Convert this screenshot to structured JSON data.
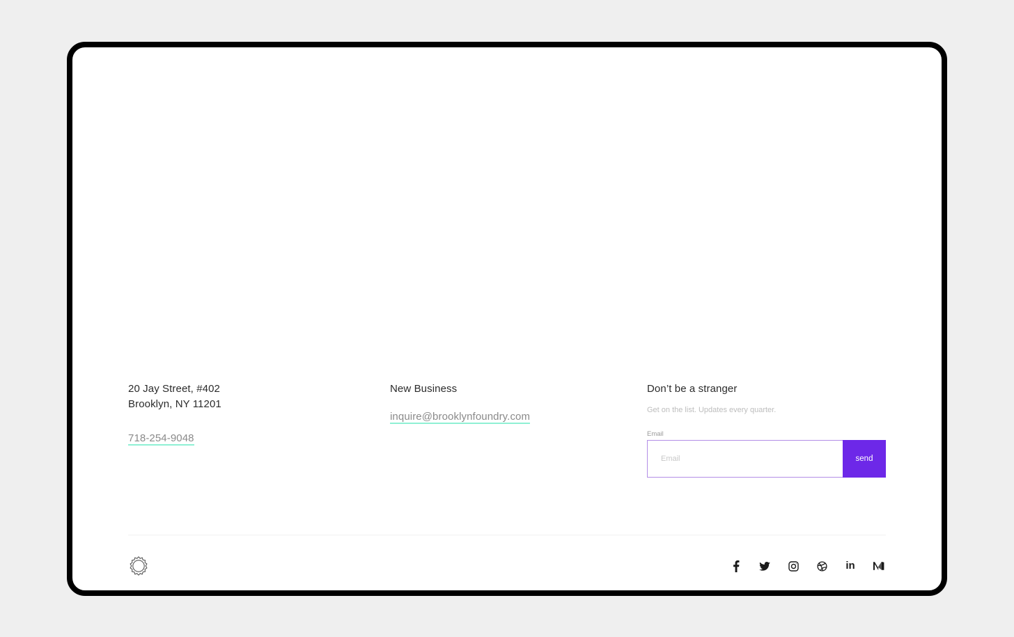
{
  "address": {
    "line1": "20 Jay Street, #402",
    "line2": "Brooklyn, NY 11201",
    "phone": "718-254-9048"
  },
  "business": {
    "heading": "New Business",
    "email": "inquire@brooklynfoundry.com"
  },
  "newsletter": {
    "heading": "Don’t be a stranger",
    "subtext": "Get on the list. Updates every quarter.",
    "field_label": "Email",
    "input_placeholder": "Email",
    "input_value": "",
    "send_label": "send"
  },
  "social": {
    "linkedin_label": "in",
    "icons": [
      "facebook-icon",
      "twitter-icon",
      "instagram-icon",
      "dribbble-icon",
      "linkedin-icon",
      "medium-icon"
    ]
  },
  "colors": {
    "accent": "#6d28e8",
    "link_underline": "#8ff0d4",
    "input_border": "#b38ee6"
  }
}
